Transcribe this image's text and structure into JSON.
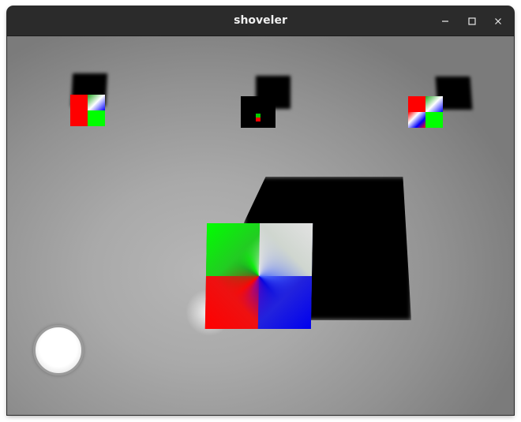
{
  "window": {
    "title": "shoveler",
    "controls": {
      "minimize_glyph": "–",
      "maximize_glyph": "☐",
      "close_glyph": "×"
    }
  },
  "scene": {
    "objects": [
      {
        "name": "small-cube-left"
      },
      {
        "name": "small-cube-center"
      },
      {
        "name": "small-cube-right"
      },
      {
        "name": "big-cube"
      },
      {
        "name": "touch-joystick"
      }
    ],
    "colors": {
      "background_light": "#b6b6b6",
      "background_dark": "#7b7b7b",
      "shadow": "#000000",
      "red": "#ff0000",
      "green": "#00ff00",
      "blue": "#0000ee",
      "white": "#e2e2e2"
    }
  }
}
